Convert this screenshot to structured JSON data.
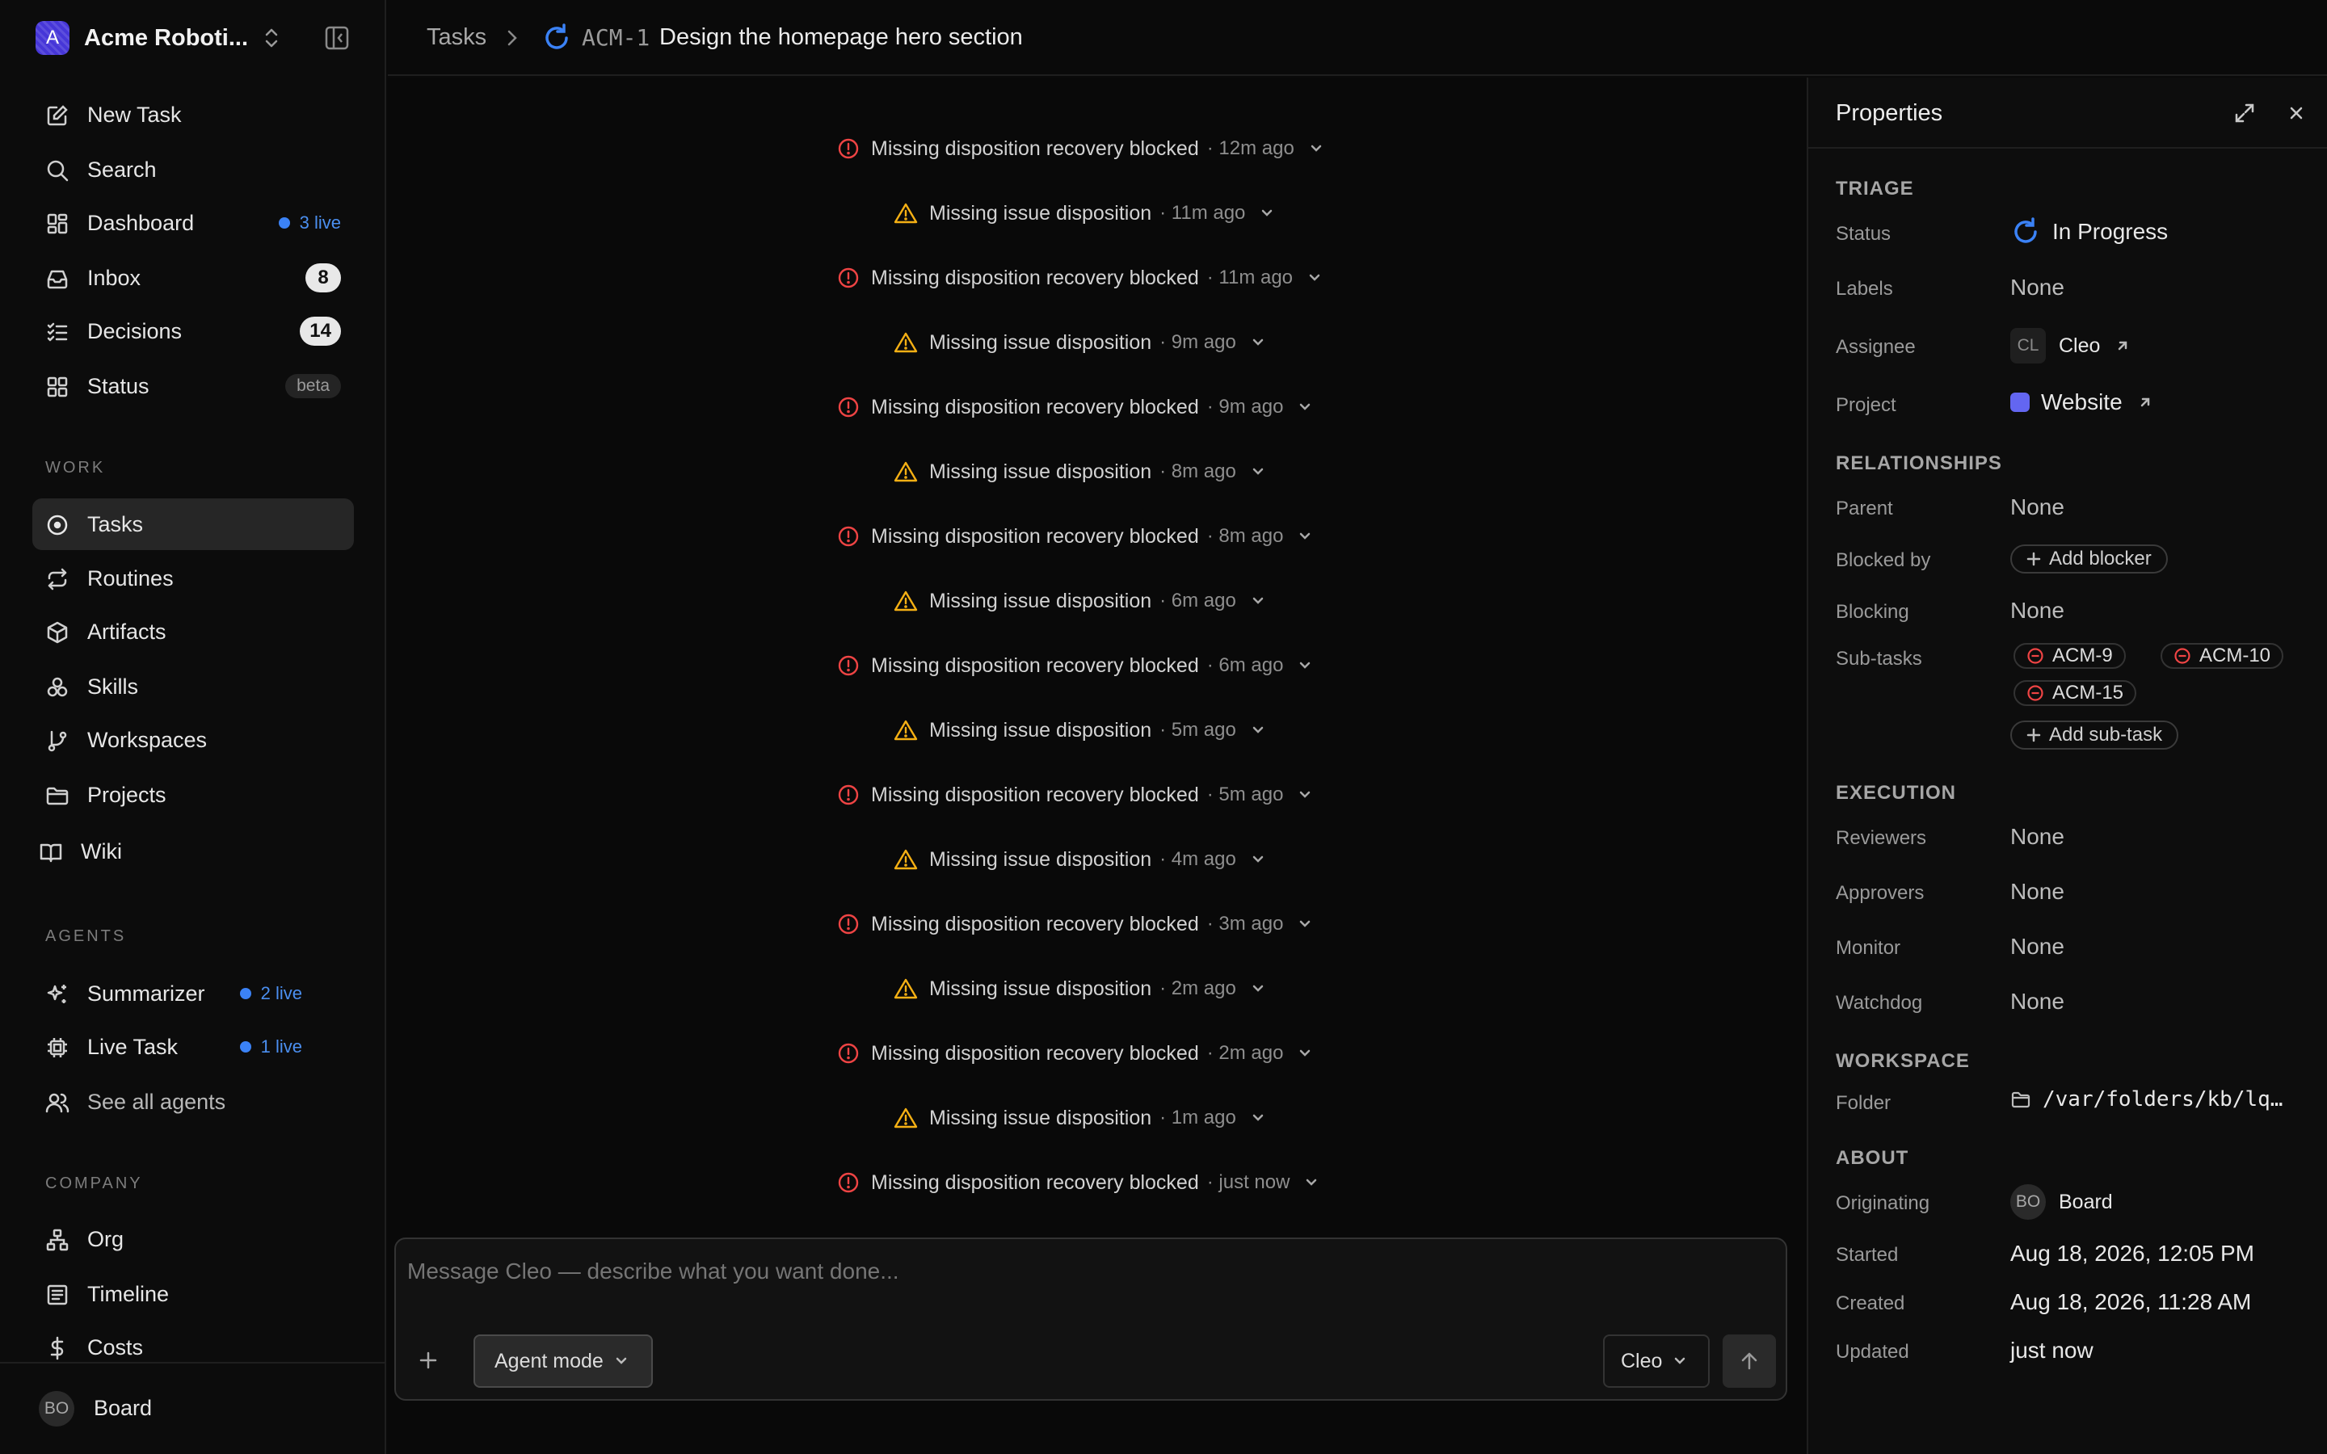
{
  "workspace": {
    "name": "Acme Roboti...",
    "logo_letter": "A"
  },
  "nav_main": [
    {
      "label": "New Task",
      "icon": "edit-icon"
    },
    {
      "label": "Search",
      "icon": "search-icon"
    },
    {
      "label": "Dashboard",
      "icon": "dashboard-icon",
      "live": "3 live"
    },
    {
      "label": "Inbox",
      "icon": "inbox-icon",
      "badge": "8"
    },
    {
      "label": "Decisions",
      "icon": "checklist-icon",
      "badge": "14"
    },
    {
      "label": "Status",
      "icon": "grid-icon",
      "beta": "beta"
    }
  ],
  "sections": {
    "work": "WORK",
    "agents": "AGENTS",
    "company": "COMPANY"
  },
  "nav_work": [
    {
      "label": "Tasks",
      "icon": "circle-dot-icon"
    },
    {
      "label": "Routines",
      "icon": "repeat-icon"
    },
    {
      "label": "Artifacts",
      "icon": "box-icon"
    },
    {
      "label": "Skills",
      "icon": "blocks-icon"
    },
    {
      "label": "Workspaces",
      "icon": "git-branch-icon"
    },
    {
      "label": "Projects",
      "icon": "folder-icon"
    },
    {
      "label": "Wiki",
      "icon": "book-icon"
    }
  ],
  "nav_agents": [
    {
      "label": "Summarizer",
      "icon": "sparkles-icon",
      "live": "2 live"
    },
    {
      "label": "Live Task",
      "icon": "cpu-icon",
      "live": "1 live"
    },
    {
      "label": "See all agents",
      "icon": "users-icon"
    }
  ],
  "nav_company": [
    {
      "label": "Org",
      "icon": "org-chart-icon"
    },
    {
      "label": "Timeline",
      "icon": "timeline-icon"
    },
    {
      "label": "Costs",
      "icon": "dollar-icon"
    }
  ],
  "user": {
    "initials": "BO",
    "name": "Board"
  },
  "breadcrumb": {
    "root": "Tasks",
    "task_id": "ACM-1",
    "task_title": "Design the homepage hero section"
  },
  "events": [
    {
      "text": "Missing disposition recovery blocked",
      "time": "· 12m ago",
      "kind": "error"
    },
    {
      "text": "Missing issue disposition",
      "time": "· 11m ago",
      "kind": "warning"
    },
    {
      "text": "Missing disposition recovery blocked",
      "time": "· 11m ago",
      "kind": "error"
    },
    {
      "text": "Missing issue disposition",
      "time": "· 9m ago",
      "kind": "warning"
    },
    {
      "text": "Missing disposition recovery blocked",
      "time": "· 9m ago",
      "kind": "error"
    },
    {
      "text": "Missing issue disposition",
      "time": "· 8m ago",
      "kind": "warning"
    },
    {
      "text": "Missing disposition recovery blocked",
      "time": "· 8m ago",
      "kind": "error"
    },
    {
      "text": "Missing issue disposition",
      "time": "· 6m ago",
      "kind": "warning"
    },
    {
      "text": "Missing disposition recovery blocked",
      "time": "· 6m ago",
      "kind": "error"
    },
    {
      "text": "Missing issue disposition",
      "time": "· 5m ago",
      "kind": "warning"
    },
    {
      "text": "Missing disposition recovery blocked",
      "time": "· 5m ago",
      "kind": "error"
    },
    {
      "text": "Missing issue disposition",
      "time": "· 4m ago",
      "kind": "warning"
    },
    {
      "text": "Missing disposition recovery blocked",
      "time": "· 3m ago",
      "kind": "error"
    },
    {
      "text": "Missing issue disposition",
      "time": "· 2m ago",
      "kind": "warning"
    },
    {
      "text": "Missing disposition recovery blocked",
      "time": "· 2m ago",
      "kind": "error"
    },
    {
      "text": "Missing issue disposition",
      "time": "· 1m ago",
      "kind": "warning"
    },
    {
      "text": "Missing disposition recovery blocked",
      "time": "· just now",
      "kind": "error"
    }
  ],
  "composer": {
    "placeholder": "Message Cleo — describe what you want done...",
    "mode": "Agent mode",
    "agent": "Cleo"
  },
  "properties": {
    "title": "Properties",
    "triage": "TRIAGE",
    "status_label": "Status",
    "status": "In Progress",
    "labels_label": "Labels",
    "labels": "None",
    "assignee_label": "Assignee",
    "assignee_initials": "CL",
    "assignee": "Cleo",
    "project_label": "Project",
    "project": "Website",
    "project_color": "#6366f1",
    "relationships": "RELATIONSHIPS",
    "parent_label": "Parent",
    "parent": "None",
    "blocked_by_label": "Blocked by",
    "add_blocker": "Add blocker",
    "blocking_label": "Blocking",
    "blocking": "None",
    "subtasks_label": "Sub-tasks",
    "subtasks": [
      "ACM-9",
      "ACM-10",
      "ACM-15"
    ],
    "add_subtask": "Add sub-task",
    "execution": "EXECUTION",
    "reviewers_label": "Reviewers",
    "reviewers": "None",
    "approvers_label": "Approvers",
    "approvers": "None",
    "monitor_label": "Monitor",
    "monitor": "None",
    "watchdog_label": "Watchdog",
    "watchdog": "None",
    "workspace_sec": "WORKSPACE",
    "folder_label": "Folder",
    "folder": "/var/folders/kb/lq…",
    "about": "ABOUT",
    "originating_label": "Originating",
    "originating_initials": "BO",
    "originating": "Board",
    "started_label": "Started",
    "started": "Aug 18, 2026, 12:05 PM",
    "created_label": "Created",
    "created": "Aug 18, 2026, 11:28 AM",
    "updated_label": "Updated",
    "updated": "just now"
  },
  "colors": {
    "accent": "#3b82f6",
    "error": "#ef4444",
    "warning": "#f5b014",
    "live": "#3b82f6"
  }
}
